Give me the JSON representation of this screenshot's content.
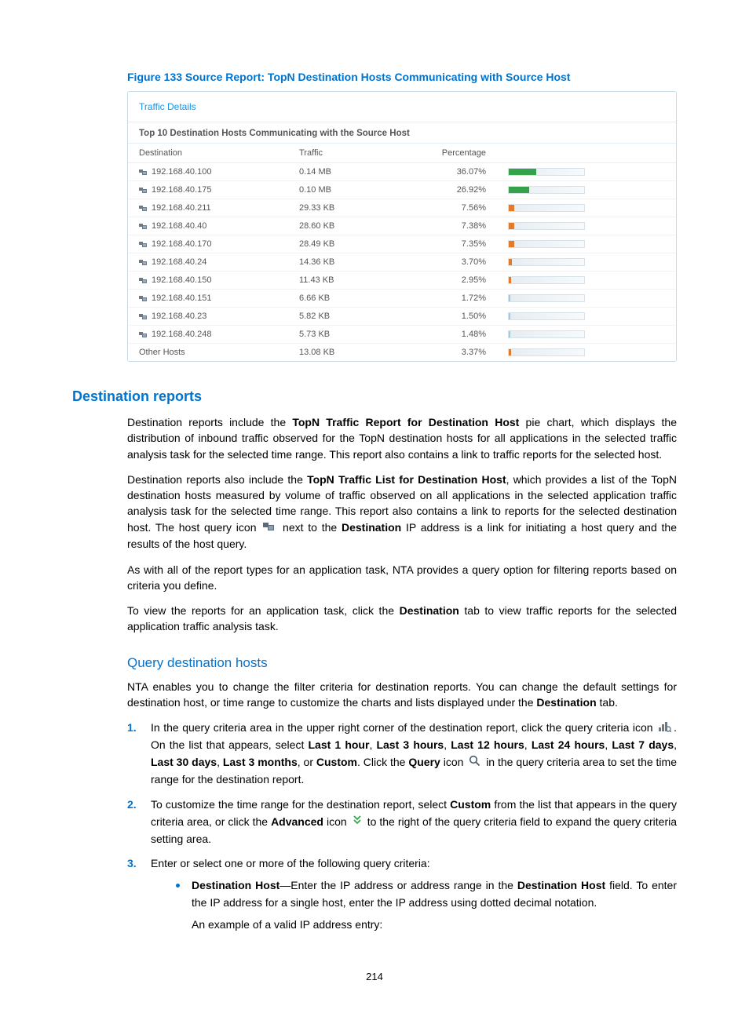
{
  "figure": {
    "caption": "Figure 133 Source Report: TopN Destination Hosts Communicating with Source Host",
    "panel_link": "Traffic Details",
    "panel_title": "Top 10 Destination Hosts Communicating with the Source Host",
    "columns": {
      "dest": "Destination",
      "traffic": "Traffic",
      "pct": "Percentage"
    },
    "rows": [
      {
        "dest": "192.168.40.100",
        "traffic": "0.14 MB",
        "pct": "36.07%",
        "bar": 36.07,
        "color": "#34a24a",
        "icon": true
      },
      {
        "dest": "192.168.40.175",
        "traffic": "0.10 MB",
        "pct": "26.92%",
        "bar": 26.92,
        "color": "#34a24a",
        "icon": true
      },
      {
        "dest": "192.168.40.211",
        "traffic": "29.33 KB",
        "pct": "7.56%",
        "bar": 7.56,
        "color": "#e07b2e",
        "icon": true
      },
      {
        "dest": "192.168.40.40",
        "traffic": "28.60 KB",
        "pct": "7.38%",
        "bar": 7.38,
        "color": "#e07b2e",
        "icon": true
      },
      {
        "dest": "192.168.40.170",
        "traffic": "28.49 KB",
        "pct": "7.35%",
        "bar": 7.35,
        "color": "#e07b2e",
        "icon": true
      },
      {
        "dest": "192.168.40.24",
        "traffic": "14.36 KB",
        "pct": "3.70%",
        "bar": 3.7,
        "color": "#e07b2e",
        "icon": true
      },
      {
        "dest": "192.168.40.150",
        "traffic": "11.43 KB",
        "pct": "2.95%",
        "bar": 2.95,
        "color": "#e07b2e",
        "icon": true
      },
      {
        "dest": "192.168.40.151",
        "traffic": "6.66 KB",
        "pct": "1.72%",
        "bar": 1.72,
        "color": "#9ec8e6",
        "icon": true
      },
      {
        "dest": "192.168.40.23",
        "traffic": "5.82 KB",
        "pct": "1.50%",
        "bar": 1.5,
        "color": "#9ec8e6",
        "icon": true
      },
      {
        "dest": "192.168.40.248",
        "traffic": "5.73 KB",
        "pct": "1.48%",
        "bar": 1.48,
        "color": "#9ec8e6",
        "icon": true
      },
      {
        "dest": "Other Hosts",
        "traffic": "13.08 KB",
        "pct": "3.37%",
        "bar": 3.37,
        "color": "#e07b2e",
        "icon": false
      }
    ]
  },
  "sections": {
    "h2": "Destination reports",
    "h3": "Query destination hosts"
  },
  "paragraphs": {
    "p1a": "Destination reports include the ",
    "p1b": "TopN Traffic Report for Destination Host",
    "p1c": " pie chart, which displays the distribution of inbound traffic observed for the TopN destination hosts for all applications in the selected traffic analysis task for the selected time range. This report also contains a link to traffic reports for the selected host.",
    "p2a": "Destination reports also include the ",
    "p2b": "TopN Traffic List for Destination Host",
    "p2c": ", which provides a list of the TopN destination hosts measured by volume of traffic observed on all applications in the selected application traffic analysis task for the selected time range. This report also contains a link to reports for the selected destination host. The host query icon ",
    "p2d": " next to the ",
    "p2e": "Destination",
    "p2f": " IP address is a link for initiating a host query and the results of the host query.",
    "p3": "As with all of the report types for an application task, NTA provides a query option for filtering reports based on criteria you define.",
    "p4a": "To view the reports for an application task, click the ",
    "p4b": "Destination",
    "p4c": " tab to view traffic reports for the selected application traffic analysis task.",
    "q1a": "NTA enables you to change the filter criteria for destination reports. You can change the default settings for destination host, or time range to customize the charts and lists displayed under the ",
    "q1b": "Destination",
    "q1c": " tab."
  },
  "steps": {
    "s1a": "In the query criteria area in the upper right corner of the destination report, click the query criteria icon ",
    "s1b": ". On the list that appears, select ",
    "s1_opts": [
      "Last 1 hour",
      "Last 3 hours",
      "Last 12 hours",
      "Last 24 hours",
      "Last 7 days",
      "Last 30 days",
      "Last 3 months",
      "Custom"
    ],
    "s1_or": ", or ",
    "s1c": ". Click the ",
    "s1d": "Query",
    "s1e": " icon ",
    "s1f": " in the query criteria area to set the time range for the destination report.",
    "s2a": "To customize the time range for the destination report, select ",
    "s2b": "Custom",
    "s2c": " from the list that appears in the query criteria area, or click the ",
    "s2d": "Advanced",
    "s2e": " icon ",
    "s2f": " to the right of the query criteria field to expand the query criteria setting area.",
    "s3": "Enter or select one or more of the following query criteria:",
    "s3_sub_label": "Destination Host",
    "s3_sub_a": "—Enter the IP address or address range in the ",
    "s3_sub_b": "Destination Host",
    "s3_sub_c": " field. To enter the IP address for a single host, enter the IP address using dotted decimal notation.",
    "s3_sub_ex": "An example of a valid IP address entry:"
  },
  "page_number": "214"
}
